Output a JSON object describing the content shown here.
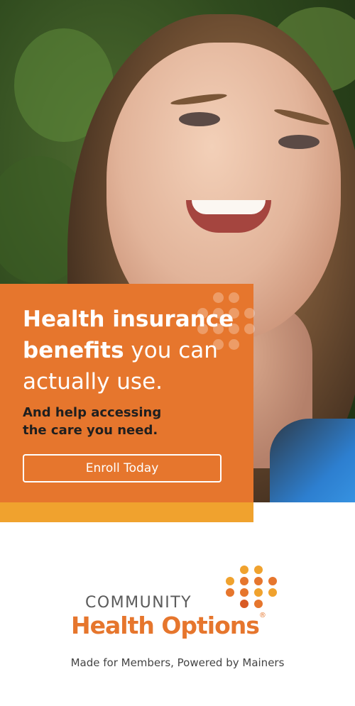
{
  "ad": {
    "headline_bold_1": "Health insurance",
    "headline_bold_2": "benefits",
    "headline_light_2": " you can",
    "headline_light_3": "actually use.",
    "sub_line_1": "And help accessing",
    "sub_line_2": "the care you need.",
    "cta_label": "Enroll Today"
  },
  "logo": {
    "community": "COMMUNITY",
    "brand": "Health Options",
    "registered": "®"
  },
  "tagline": "Made for Members, Powered by Mainers",
  "colors": {
    "brand_orange": "#e6762d",
    "accent_yellow": "#f0a22e",
    "logo_gray": "#5b5b5b"
  },
  "photo": {
    "subject": "smiling woman looking up, outdoors with green foliage background"
  }
}
